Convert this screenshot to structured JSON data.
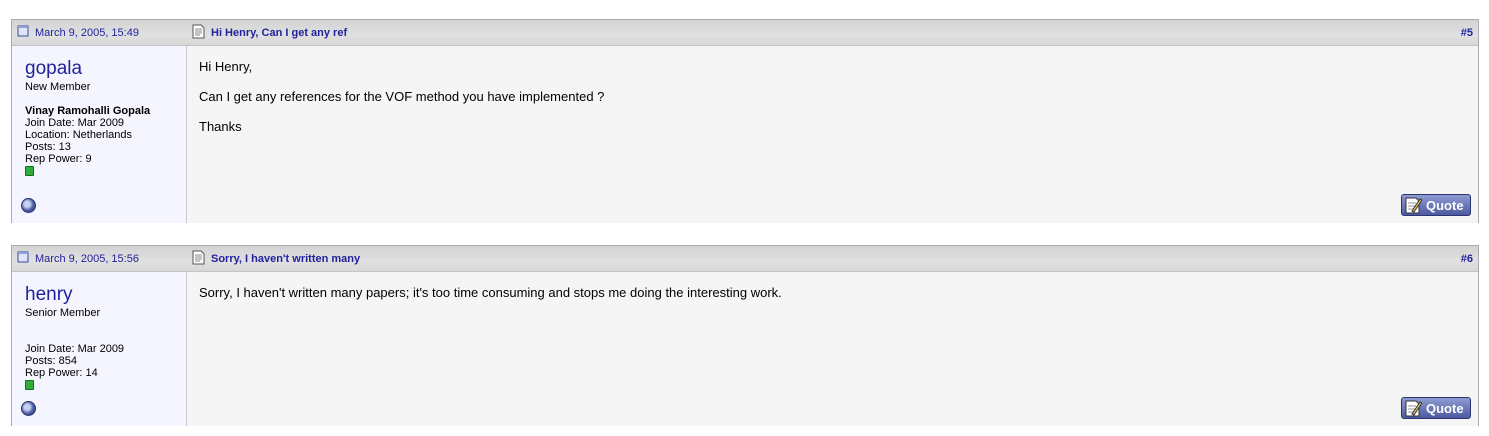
{
  "posts": [
    {
      "date": "March 9, 2005, 15:49",
      "title": "Hi Henry, Can I get any ref",
      "number": "#5",
      "username": "gopala",
      "user_title": "New Member",
      "real_name": "Vinay Ramohalli Gopala",
      "join_date": "Join Date: Mar 2009",
      "location": "Location: Netherlands",
      "posts": "Posts: 13",
      "rep_power": "Rep Power: 9",
      "message": [
        "Hi Henry,",
        "Can I get any references for the VOF method you have implemented ?",
        "Thanks"
      ],
      "quote_label": "Quote"
    },
    {
      "date": "March 9, 2005, 15:56",
      "title": "Sorry, I haven't written many",
      "number": "#6",
      "username": "henry",
      "user_title": "Senior Member",
      "join_date": "Join Date: Mar 2009",
      "posts": "Posts: 854",
      "rep_power": "Rep Power: 14",
      "message": [
        "Sorry, I haven't written many papers; it's too time consuming and stops me doing the interesting work."
      ],
      "quote_label": "Quote"
    }
  ],
  "icons": {
    "post_icon": "document-icon",
    "title_icon": "page-icon",
    "status": "offline-status-icon",
    "quote": "quote-icon"
  },
  "colors": {
    "link": "#22229c",
    "reputation": "#2fae3a",
    "quote_button": "#4c5aa0"
  }
}
